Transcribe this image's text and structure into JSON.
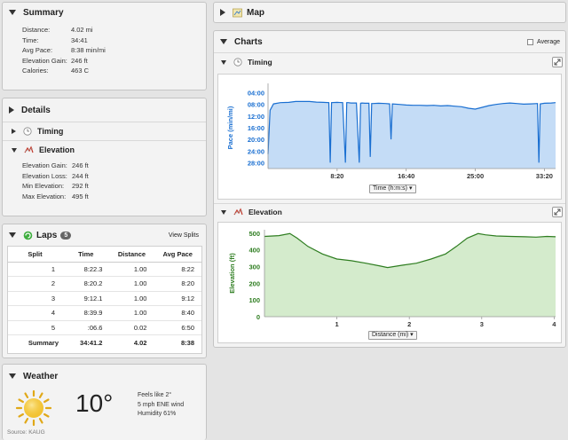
{
  "summary": {
    "title": "Summary",
    "rows": [
      {
        "label": "Distance:",
        "value": "4.02 mi"
      },
      {
        "label": "Time:",
        "value": "34:41"
      },
      {
        "label": "Avg Pace:",
        "value": "8:38 min/mi"
      },
      {
        "label": "Elevation Gain:",
        "value": "246 ft"
      },
      {
        "label": "Calories:",
        "value": "463 C"
      }
    ]
  },
  "details": {
    "title": "Details",
    "timing_label": "Timing",
    "elevation_label": "Elevation",
    "elevation_rows": [
      {
        "label": "Elevation Gain:",
        "value": "246 ft"
      },
      {
        "label": "Elevation Loss:",
        "value": "244 ft"
      },
      {
        "label": "Min Elevation:",
        "value": "292 ft"
      },
      {
        "label": "Max Elevation:",
        "value": "495 ft"
      }
    ]
  },
  "laps": {
    "title": "Laps",
    "count": "5",
    "view_splits": "View Splits",
    "headers": [
      "Split",
      "Time",
      "Distance",
      "Avg Pace"
    ],
    "rows": [
      [
        "1",
        "8:22.3",
        "1.00",
        "8:22"
      ],
      [
        "2",
        "8:20.2",
        "1.00",
        "8:20"
      ],
      [
        "3",
        "9:12.1",
        "1.00",
        "9:12"
      ],
      [
        "4",
        "8:39.9",
        "1.00",
        "8:40"
      ],
      [
        "5",
        ":06.6",
        "0.02",
        "6:50"
      ]
    ],
    "summary_row": [
      "Summary",
      "34:41.2",
      "4.02",
      "8:38"
    ]
  },
  "weather": {
    "title": "Weather",
    "temp": "10°",
    "feels_like": "Feels like 2°",
    "wind": "5 mph ENE wind",
    "humidity": "Humidity 61%",
    "source": "Source: KAUG"
  },
  "map": {
    "title": "Map"
  },
  "charts": {
    "title": "Charts",
    "average_label": "Average",
    "timing": {
      "title": "Timing",
      "x_dropdown": "Time (h:m:s)"
    },
    "elevation": {
      "title": "Elevation",
      "x_dropdown": "Distance (mi)"
    }
  },
  "colors": {
    "pace_line": "#1a6fd1",
    "pace_fill": "#c4dcf6",
    "elev_line": "#2e7d20",
    "elev_fill": "#d4ebcc",
    "sun": "#f2c230"
  },
  "chart_data": [
    {
      "type": "area",
      "ylabel": "Pace (min/mi)",
      "y_inverted": true,
      "y_ticks": [
        "04:00",
        "08:00",
        "12:00",
        "16:00",
        "20:00",
        "24:00",
        "28:00"
      ],
      "y_tick_values_min": [
        4,
        8,
        12,
        16,
        20,
        24,
        28
      ],
      "x_ticks": [
        "8:20",
        "16:40",
        "25:00",
        "33:20"
      ],
      "x_tick_values_s": [
        500,
        1000,
        1500,
        2000
      ],
      "xlim_s": [
        0,
        2081
      ],
      "ylim_min": [
        2,
        30
      ],
      "grid": false,
      "series": [
        {
          "x": [
            0,
            15,
            40,
            90,
            150,
            200,
            250,
            300,
            350,
            400,
            440,
            450,
            460,
            500,
            540,
            560,
            570,
            580,
            600,
            640,
            660,
            670,
            680,
            700,
            730,
            740,
            750,
            760,
            800,
            850,
            880,
            890,
            900,
            950,
            1000,
            1050,
            1100,
            1150,
            1200,
            1250,
            1300,
            1350,
            1400,
            1450,
            1500,
            1550,
            1600,
            1650,
            1700,
            1750,
            1800,
            1850,
            1900,
            1950,
            1960,
            1970,
            2000,
            2050,
            2081
          ],
          "y": [
            25,
            10,
            7.8,
            7.4,
            7.3,
            7.0,
            7.0,
            7.0,
            7.2,
            7.3,
            7.4,
            28,
            7.4,
            7.3,
            7.4,
            28,
            7.4,
            7.4,
            7.5,
            7.5,
            28,
            7.6,
            7.5,
            7.6,
            7.6,
            26,
            7.7,
            7.7,
            7.6,
            7.7,
            7.8,
            20,
            7.8,
            8.0,
            8.2,
            8.3,
            8.3,
            8.4,
            8.3,
            8.5,
            8.4,
            8.6,
            8.8,
            9.3,
            9.6,
            9.0,
            8.4,
            8.0,
            7.7,
            7.5,
            7.7,
            7.9,
            7.8,
            7.7,
            28,
            7.8,
            7.6,
            7.5,
            7.4
          ]
        }
      ]
    },
    {
      "type": "area",
      "ylabel": "Elevation (ft)",
      "y_ticks": [
        "0",
        "100",
        "200",
        "300",
        "400",
        "500"
      ],
      "y_tick_values": [
        0,
        100,
        200,
        300,
        400,
        500
      ],
      "x_ticks": [
        "1",
        "2",
        "3",
        "4"
      ],
      "x_tick_values": [
        1,
        2,
        3,
        4
      ],
      "xlim": [
        0,
        4.02
      ],
      "ylim": [
        0,
        520
      ],
      "grid": false,
      "series": [
        {
          "x": [
            0,
            0.2,
            0.35,
            0.45,
            0.6,
            0.8,
            1.0,
            1.2,
            1.4,
            1.6,
            1.7,
            1.9,
            2.1,
            2.3,
            2.5,
            2.65,
            2.8,
            2.95,
            3.05,
            3.2,
            3.4,
            3.6,
            3.75,
            3.9,
            4.02
          ],
          "y": [
            480,
            485,
            497,
            470,
            420,
            375,
            345,
            335,
            320,
            303,
            294,
            308,
            320,
            345,
            375,
            420,
            470,
            497,
            490,
            483,
            480,
            478,
            476,
            480,
            478
          ]
        }
      ]
    }
  ]
}
